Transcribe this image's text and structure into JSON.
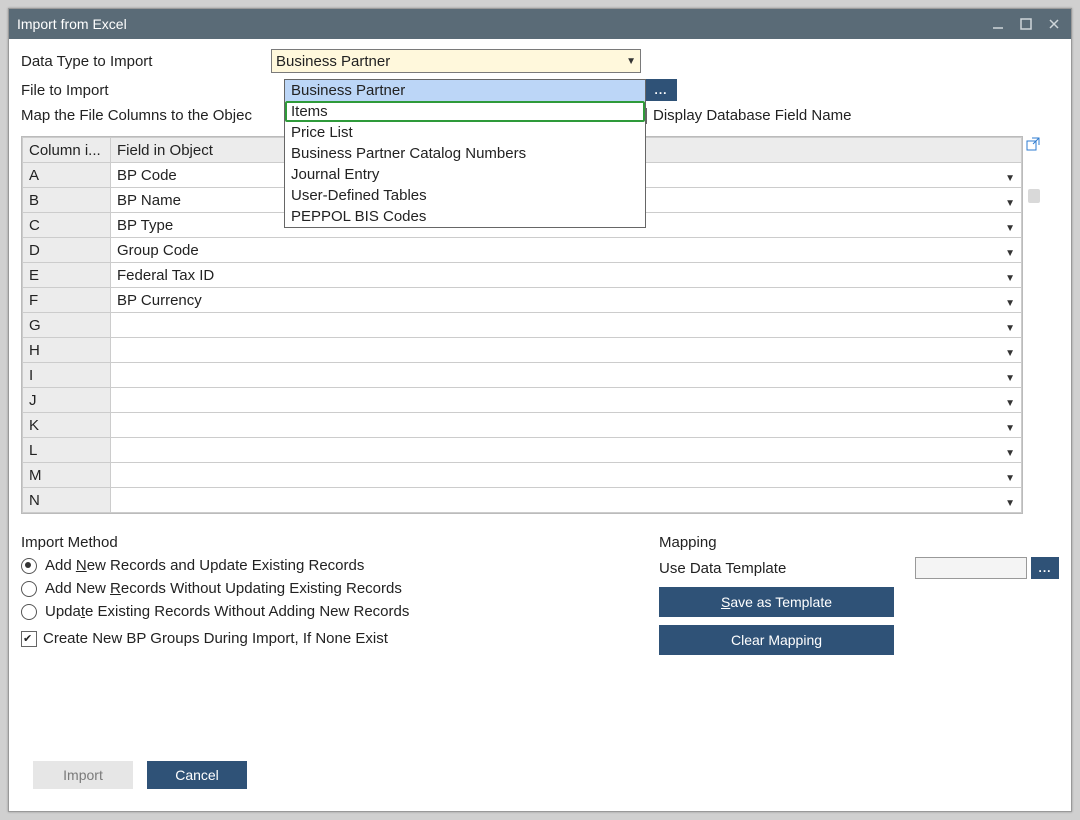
{
  "window": {
    "title": "Import from Excel"
  },
  "labels": {
    "data_type": "Data Type to Import",
    "file_to_import": "File to Import",
    "map_columns": "Map the File Columns to the Objec",
    "display_db_field": "Display Database Field Name",
    "import_method": "Import Method",
    "mapping": "Mapping",
    "use_template": "Use Data Template"
  },
  "select": {
    "value": "Business Partner",
    "options": [
      "Business Partner",
      "Items",
      "Price List",
      "Business Partner Catalog Numbers",
      "Journal Entry",
      "User-Defined Tables",
      "PEPPOL BIS Codes"
    ]
  },
  "table": {
    "headers": {
      "col": "Column i...",
      "field": "Field in Object"
    },
    "rows": [
      {
        "col": "A",
        "field": "BP Code"
      },
      {
        "col": "B",
        "field": "BP Name"
      },
      {
        "col": "C",
        "field": "BP Type"
      },
      {
        "col": "D",
        "field": "Group Code"
      },
      {
        "col": "E",
        "field": "Federal Tax ID"
      },
      {
        "col": "F",
        "field": "BP Currency"
      },
      {
        "col": "G",
        "field": ""
      },
      {
        "col": "H",
        "field": ""
      },
      {
        "col": "I",
        "field": ""
      },
      {
        "col": "J",
        "field": ""
      },
      {
        "col": "K",
        "field": ""
      },
      {
        "col": "L",
        "field": ""
      },
      {
        "col": "M",
        "field": ""
      },
      {
        "col": "N",
        "field": ""
      }
    ]
  },
  "radios": {
    "r1_pre": "Add ",
    "r1_u": "N",
    "r1_post": "ew Records and Update Existing Records",
    "r2_pre": "Add New ",
    "r2_u": "R",
    "r2_post": "ecords Without Updating Existing Records",
    "r3_pre": "Upda",
    "r3_u": "t",
    "r3_post": "e Existing Records Without Adding New Records"
  },
  "checkbox": {
    "label": "Create New BP Groups During Import, If None Exist"
  },
  "buttons": {
    "save_template_pre": "",
    "save_template_u": "S",
    "save_template_post": "ave as Template",
    "clear_mapping": "Clear Mapping",
    "import": "Import",
    "cancel": "Cancel",
    "ellipsis": "..."
  }
}
